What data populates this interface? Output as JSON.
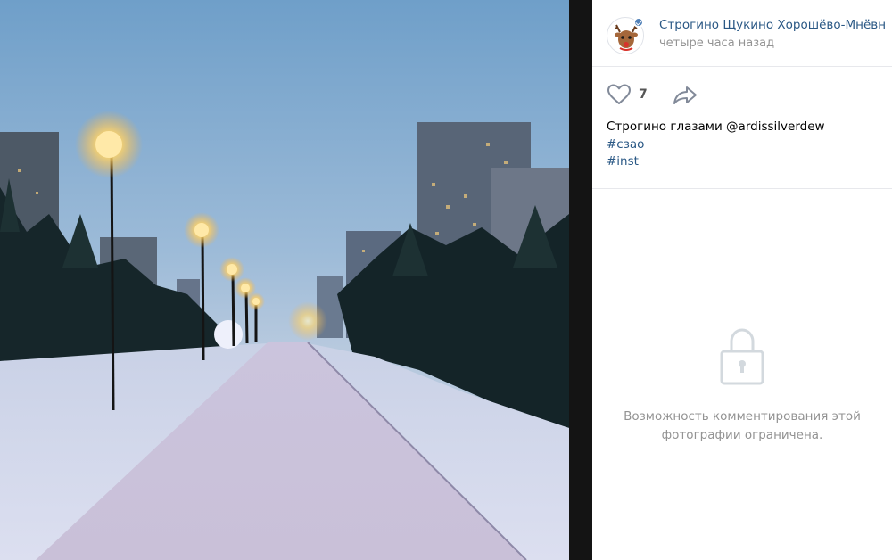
{
  "post": {
    "author_name": "Строгино Щукино Хорошёво-Мнёвники",
    "time": "четыре часа назад",
    "likes": "7",
    "caption": "Строгино глазами @ardissilverdew",
    "hashtags": [
      "#сзао",
      "#inst"
    ]
  },
  "comments": {
    "locked_message": "Возможность комментирования этой фотографии ограничена."
  },
  "icons": {
    "like": "heart-icon",
    "share": "share-arrow-icon",
    "lock": "lock-icon",
    "verified": "verified-check-icon"
  },
  "colors": {
    "link": "#2a5885",
    "muted": "#939393",
    "divider": "#141414"
  }
}
